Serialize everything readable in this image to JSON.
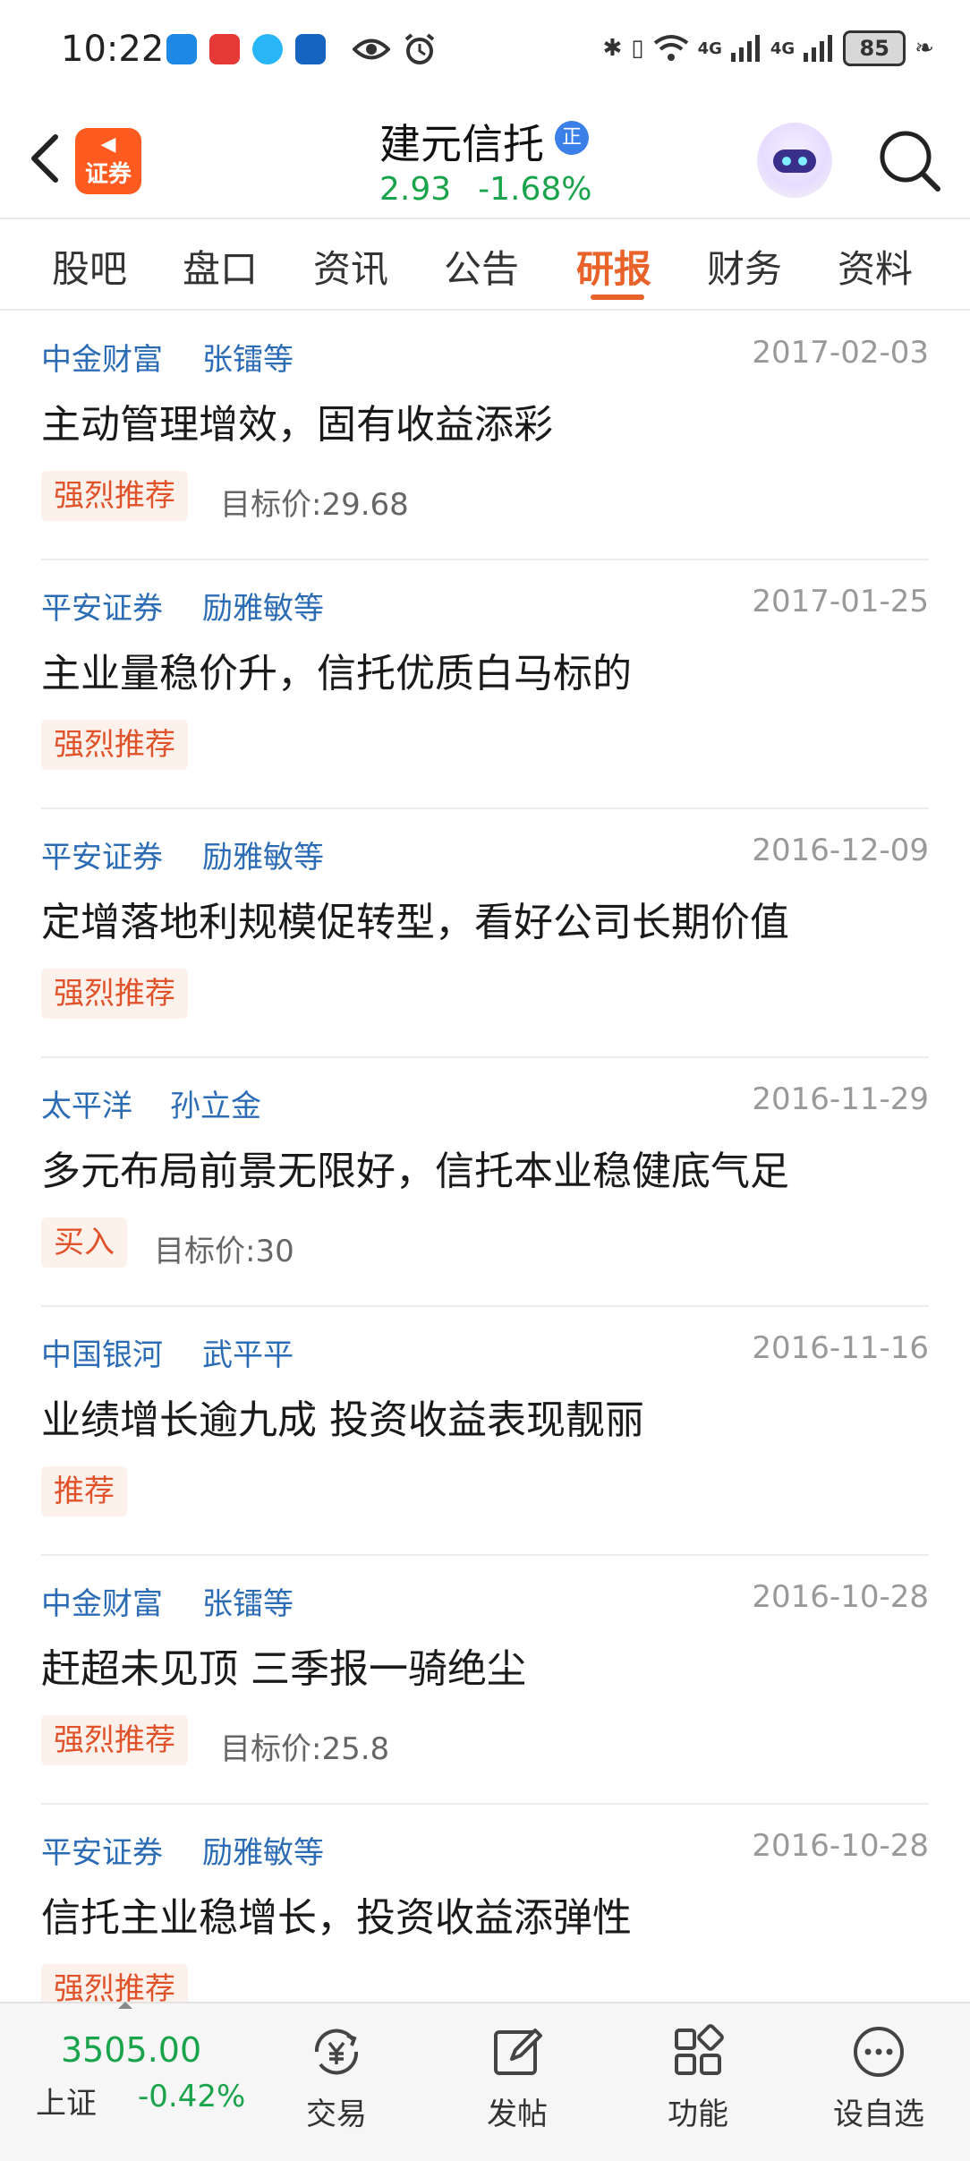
{
  "status_bar": {
    "time": "10:22",
    "network_1": "4G",
    "network_2": "4G",
    "battery": "85"
  },
  "header": {
    "logo_line1": "◀",
    "logo_text": "证券",
    "stock_name": "建元信托",
    "badge": "正",
    "price": "2.93",
    "change": "-1.68%"
  },
  "tabs": [
    {
      "label": "股吧"
    },
    {
      "label": "盘口"
    },
    {
      "label": "资讯"
    },
    {
      "label": "公告"
    },
    {
      "label": "研报",
      "active": true
    },
    {
      "label": "财务"
    },
    {
      "label": "资料"
    }
  ],
  "reports": [
    {
      "org": "中金财富",
      "author": "张镭等",
      "date": "2017-02-03",
      "title": "主动管理增效，固有收益添彩",
      "rating": "强烈推荐",
      "target": "目标价:29.68"
    },
    {
      "org": "平安证券",
      "author": "励雅敏等",
      "date": "2017-01-25",
      "title": "主业量稳价升，信托优质白马标的",
      "rating": "强烈推荐",
      "target": ""
    },
    {
      "org": "平安证券",
      "author": "励雅敏等",
      "date": "2016-12-09",
      "title": "定增落地利规模促转型，看好公司长期价值",
      "rating": "强烈推荐",
      "target": ""
    },
    {
      "org": "太平洋",
      "author": "孙立金",
      "date": "2016-11-29",
      "title": "多元布局前景无限好，信托本业稳健底气足",
      "rating": "买入",
      "target": "目标价:30"
    },
    {
      "org": "中国银河",
      "author": "武平平",
      "date": "2016-11-16",
      "title": "业绩增长逾九成 投资收益表现靓丽",
      "rating": "推荐",
      "target": ""
    },
    {
      "org": "中金财富",
      "author": "张镭等",
      "date": "2016-10-28",
      "title": "赶超未见顶 三季报一骑绝尘",
      "rating": "强烈推荐",
      "target": "目标价:25.8"
    },
    {
      "org": "平安证券",
      "author": "励雅敏等",
      "date": "2016-10-28",
      "title": "信托主业稳增长，投资收益添弹性",
      "rating": "强烈推荐",
      "target": ""
    }
  ],
  "bottom_bar": {
    "index_value": "3505.00",
    "index_name": "上证",
    "index_change": "-0.42%",
    "items": [
      {
        "label": "交易",
        "icon": "trade-icon"
      },
      {
        "label": "发帖",
        "icon": "post-icon"
      },
      {
        "label": "功能",
        "icon": "functions-icon"
      },
      {
        "label": "设自选",
        "icon": "more-icon"
      }
    ]
  },
  "colors": {
    "accent": "#e8622a",
    "fall": "#19a34b",
    "link": "#2b6cb5"
  }
}
